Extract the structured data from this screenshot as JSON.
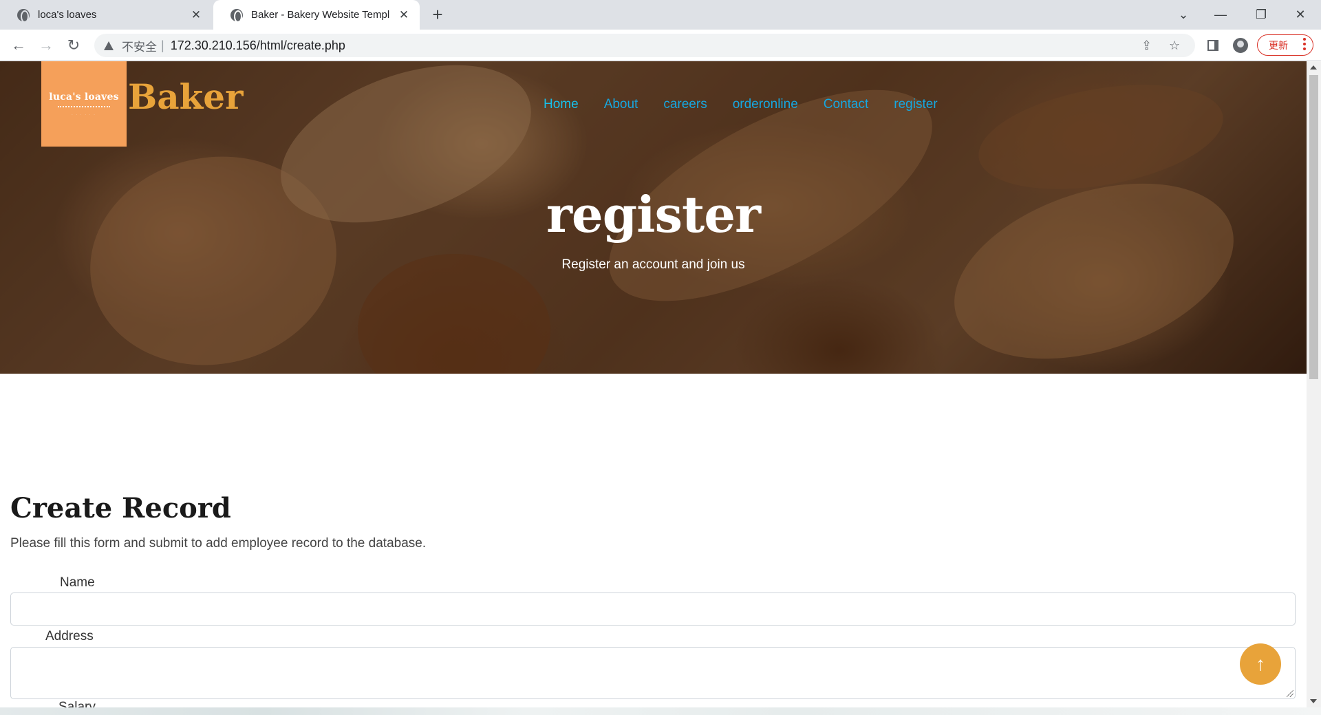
{
  "browser": {
    "tabs": [
      {
        "title": "loca's loaves"
      },
      {
        "title": "Baker - Bakery Website Templ"
      }
    ],
    "address": {
      "security_label": "不安全",
      "separator": "|",
      "url": "172.30.210.156/html/create.php"
    },
    "update_label": "更新"
  },
  "site": {
    "logo_text": "luca's loaves",
    "brand": "Baker",
    "nav": [
      {
        "label": "Home"
      },
      {
        "label": "About"
      },
      {
        "label": "careers"
      },
      {
        "label": "orderonline"
      },
      {
        "label": "Contact"
      },
      {
        "label": "register"
      }
    ],
    "hero": {
      "title": "register",
      "subtitle": "Register an account and join us"
    }
  },
  "form": {
    "title": "Create Record",
    "description": "Please fill this form and submit to add employee record to the database.",
    "fields": [
      {
        "label": "Name",
        "value": ""
      },
      {
        "label": "Address",
        "value": ""
      },
      {
        "label": "Salary",
        "value": ""
      }
    ]
  },
  "colors": {
    "brand": "#e8a33a",
    "logo_bg": "#f5a05a",
    "nav_link": "#16a7e0",
    "update_red": "#d93025"
  },
  "icons": {
    "back_to_top": "arrow-up-icon"
  }
}
